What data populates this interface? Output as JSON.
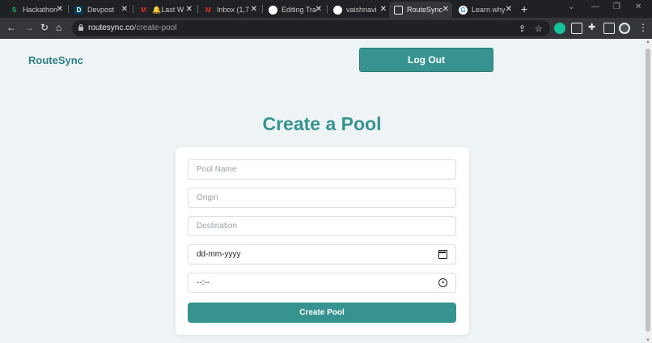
{
  "browser": {
    "tabs": [
      {
        "title": "Hackathon",
        "icon": "s-logo-icon",
        "color": "#1db954"
      },
      {
        "title": "Devpost",
        "icon": "devpost-icon",
        "color": "#003e54"
      },
      {
        "title": "🔔Last W",
        "icon": "gmail-icon",
        "color": "#d93025"
      },
      {
        "title": "Inbox (1,7",
        "icon": "gmail-icon",
        "color": "#d93025"
      },
      {
        "title": "Editing Tra",
        "icon": "github-icon",
        "color": "#ffffff"
      },
      {
        "title": "vaishnavi",
        "icon": "github-icon",
        "color": "#ffffff"
      },
      {
        "title": "RouteSync",
        "icon": "page-icon",
        "color": "#e8eaed"
      },
      {
        "title": "Learn why",
        "icon": "google-icon",
        "color": "#4285f4"
      }
    ],
    "url_host": "routesync.co",
    "url_path": "/create-pool"
  },
  "header": {
    "brand": "RouteSync",
    "logout_label": "Log Out"
  },
  "main": {
    "title": "Create a Pool",
    "fields": {
      "pool_name_placeholder": "Pool Name",
      "origin_placeholder": "Origin",
      "destination_placeholder": "Destination",
      "date_value": "dd-mm-yyyy",
      "time_value": "--:--"
    },
    "submit_label": "Create Pool"
  },
  "colors": {
    "accent": "#37938f",
    "brand": "#2f7f80",
    "page_bg": "#eef3f6"
  }
}
